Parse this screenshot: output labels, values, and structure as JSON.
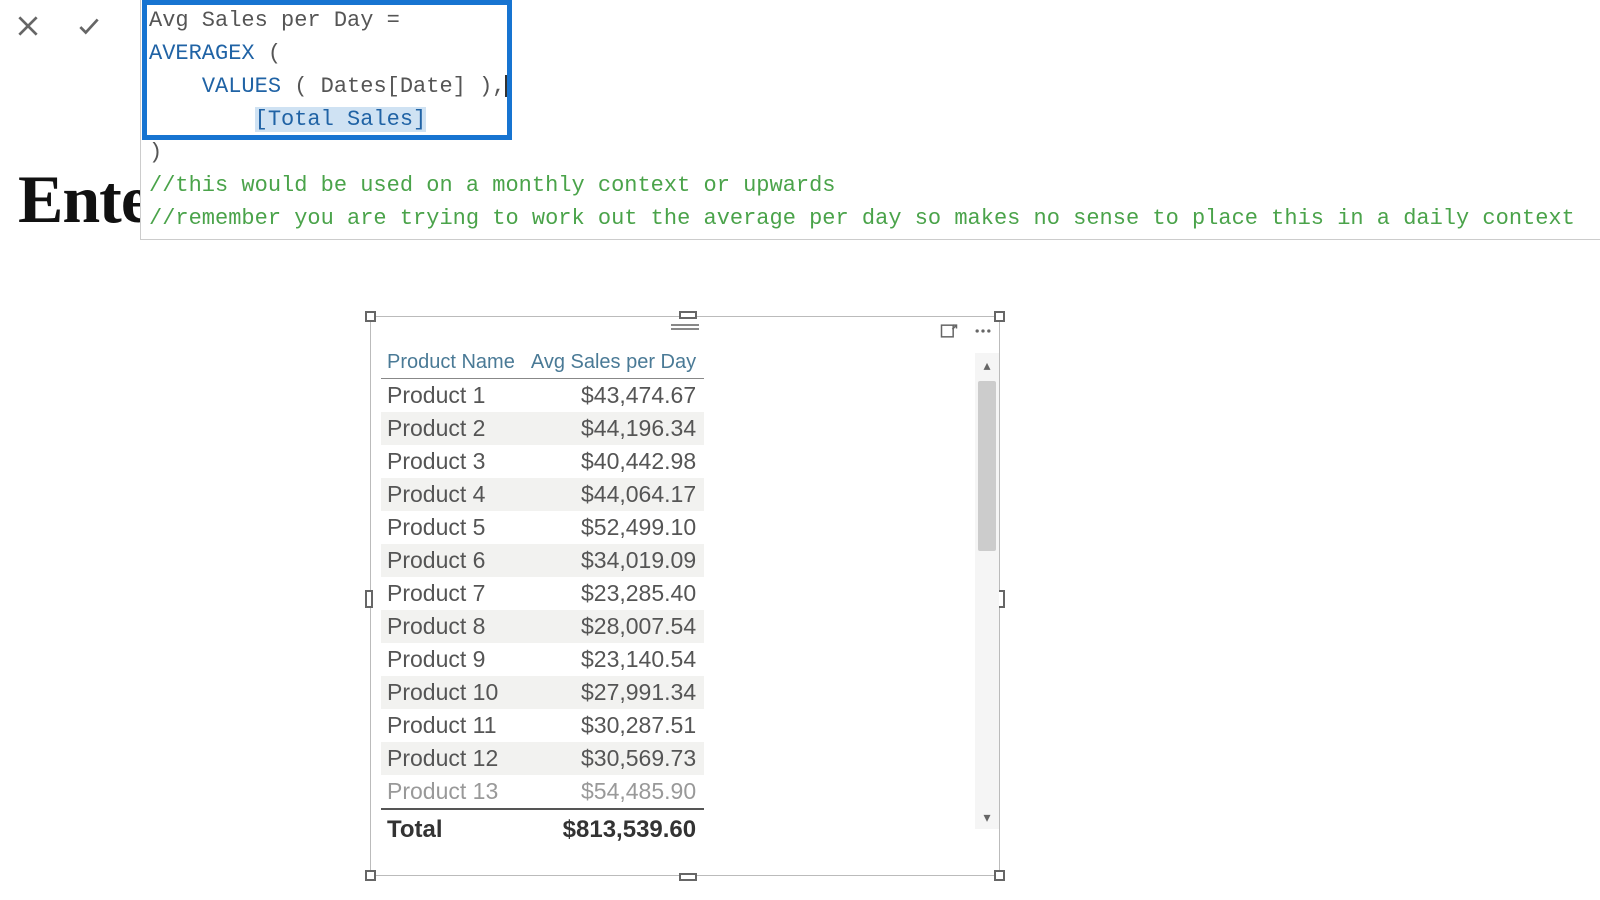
{
  "toolbar": {
    "cancel": "×",
    "commit": "✓"
  },
  "formula": {
    "line1_name": "Avg Sales per Day = ",
    "line2_fn": "AVERAGEX",
    "line2_rest": " (",
    "line3_fn": "VALUES",
    "line3_rest": " ( Dates[Date] ),",
    "line4_measure": "[Total Sales]",
    "line5": ")",
    "comment1": "//this would be used on a monthly context or upwards",
    "comment2": "//remember you are trying to work out the average per day so makes no sense to place this in a daily context"
  },
  "bgTitle": "Ente",
  "table": {
    "headers": {
      "c1": "Product Name",
      "c2": "Avg Sales per Day"
    },
    "rows": [
      {
        "name": "Product 1",
        "val": "$43,474.67"
      },
      {
        "name": "Product 2",
        "val": "$44,196.34"
      },
      {
        "name": "Product 3",
        "val": "$40,442.98"
      },
      {
        "name": "Product 4",
        "val": "$44,064.17"
      },
      {
        "name": "Product 5",
        "val": "$52,499.10"
      },
      {
        "name": "Product 6",
        "val": "$34,019.09"
      },
      {
        "name": "Product 7",
        "val": "$23,285.40"
      },
      {
        "name": "Product 8",
        "val": "$28,007.54"
      },
      {
        "name": "Product 9",
        "val": "$23,140.54"
      },
      {
        "name": "Product 10",
        "val": "$27,991.34"
      },
      {
        "name": "Product 11",
        "val": "$30,287.51"
      },
      {
        "name": "Product 12",
        "val": "$30,569.73"
      },
      {
        "name": "Product 13",
        "val": "$54,485.90"
      }
    ],
    "totalLabel": "Total",
    "totalValue": "$813,539.60"
  }
}
